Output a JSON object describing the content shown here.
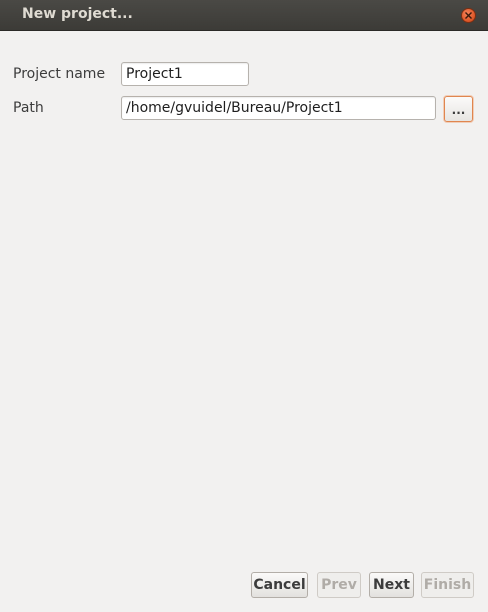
{
  "window": {
    "title": "New project..."
  },
  "form": {
    "project_name_label": "Project name",
    "project_name_value": "Project1",
    "path_label": "Path",
    "path_value": "/home/gvuidel/Bureau/Project1",
    "browse_label": "..."
  },
  "footer": {
    "cancel_label": "Cancel",
    "prev_label": "Prev",
    "next_label": "Next",
    "finish_label": "Finish"
  },
  "colors": {
    "titlebar": "#3c3b37",
    "window_bg": "#f2f1f0",
    "close_button": "#e05a2b",
    "focus_outline": "#e0864f"
  }
}
